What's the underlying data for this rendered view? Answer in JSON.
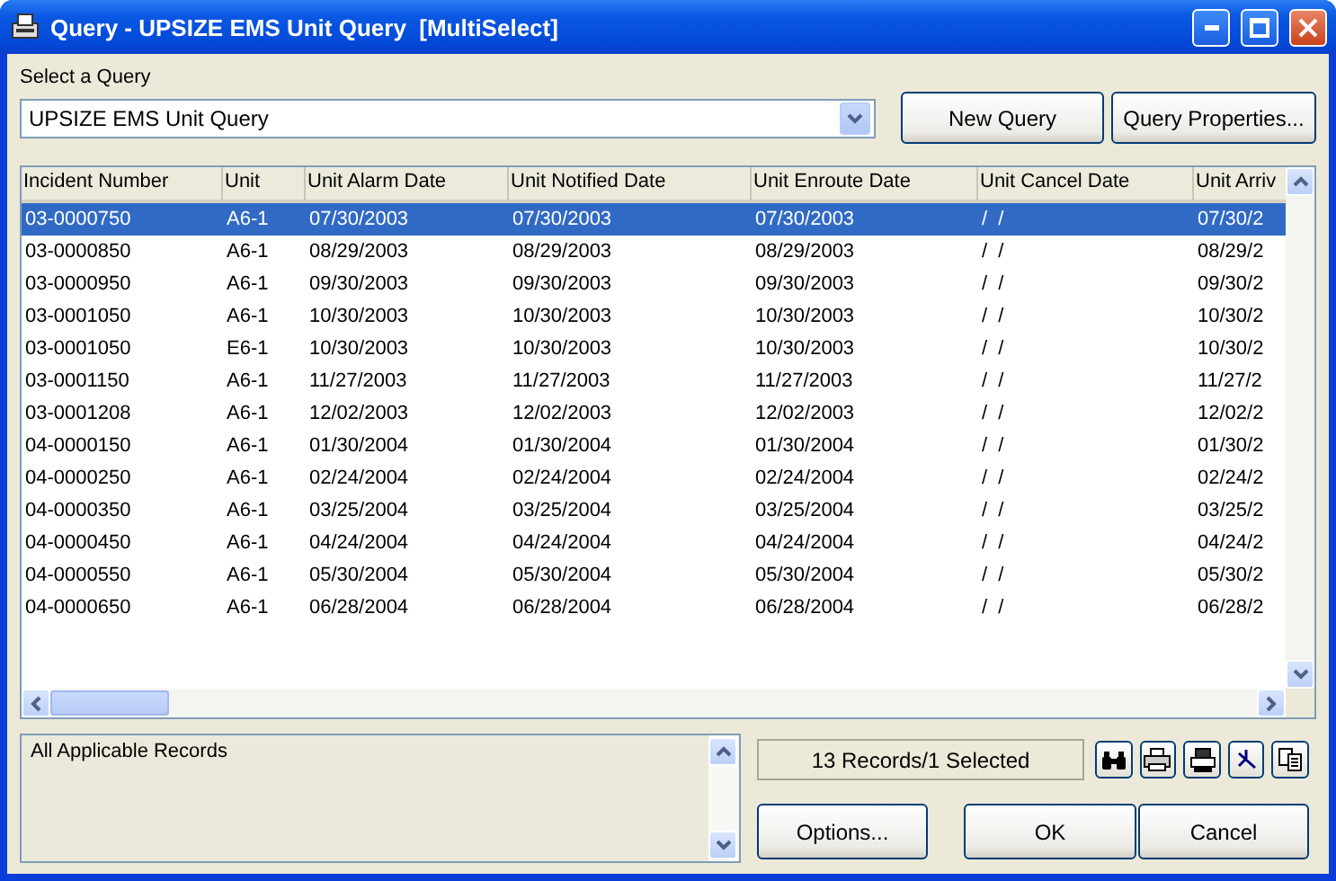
{
  "window": {
    "title": "Query - UPSIZE EMS Unit Query  [MultiSelect]"
  },
  "query_select": {
    "label": "Select a Query",
    "value": "UPSIZE EMS Unit Query"
  },
  "top_buttons": [
    "New Query",
    "Query Properties..."
  ],
  "table": {
    "columns": [
      "Incident Number",
      "Unit",
      "Unit Alarm Date",
      "Unit Notified Date",
      "Unit Enroute Date",
      "Unit Cancel Date",
      "Unit Arriv"
    ],
    "rows": [
      {
        "selected": true,
        "cells": [
          "03-0000750",
          "A6-1",
          "07/30/2003",
          "07/30/2003",
          "07/30/2003",
          "/  /",
          "07/30/2"
        ]
      },
      {
        "selected": false,
        "cells": [
          "03-0000850",
          "A6-1",
          "08/29/2003",
          "08/29/2003",
          "08/29/2003",
          "/  /",
          "08/29/2"
        ]
      },
      {
        "selected": false,
        "cells": [
          "03-0000950",
          "A6-1",
          "09/30/2003",
          "09/30/2003",
          "09/30/2003",
          "/  /",
          "09/30/2"
        ]
      },
      {
        "selected": false,
        "cells": [
          "03-0001050",
          "A6-1",
          "10/30/2003",
          "10/30/2003",
          "10/30/2003",
          "/  /",
          "10/30/2"
        ]
      },
      {
        "selected": false,
        "cells": [
          "03-0001050",
          "E6-1",
          "10/30/2003",
          "10/30/2003",
          "10/30/2003",
          "/  /",
          "10/30/2"
        ]
      },
      {
        "selected": false,
        "cells": [
          "03-0001150",
          "A6-1",
          "11/27/2003",
          "11/27/2003",
          "11/27/2003",
          "/  /",
          "11/27/2"
        ]
      },
      {
        "selected": false,
        "cells": [
          "03-0001208",
          "A6-1",
          "12/02/2003",
          "12/02/2003",
          "12/02/2003",
          "/  /",
          "12/02/2"
        ]
      },
      {
        "selected": false,
        "cells": [
          "04-0000150",
          "A6-1",
          "01/30/2004",
          "01/30/2004",
          "01/30/2004",
          "/  /",
          "01/30/2"
        ]
      },
      {
        "selected": false,
        "cells": [
          "04-0000250",
          "A6-1",
          "02/24/2004",
          "02/24/2004",
          "02/24/2004",
          "/  /",
          "02/24/2"
        ]
      },
      {
        "selected": false,
        "cells": [
          "04-0000350",
          "A6-1",
          "03/25/2004",
          "03/25/2004",
          "03/25/2004",
          "/  /",
          "03/25/2"
        ]
      },
      {
        "selected": false,
        "cells": [
          "04-0000450",
          "A6-1",
          "04/24/2004",
          "04/24/2004",
          "04/24/2004",
          "/  /",
          "04/24/2"
        ]
      },
      {
        "selected": false,
        "cells": [
          "04-0000550",
          "A6-1",
          "05/30/2004",
          "05/30/2004",
          "05/30/2004",
          "/  /",
          "05/30/2"
        ]
      },
      {
        "selected": false,
        "cells": [
          "04-0000650",
          "A6-1",
          "06/28/2004",
          "06/28/2004",
          "06/28/2004",
          "/  /",
          "06/28/2"
        ]
      }
    ]
  },
  "description": "All Applicable Records",
  "record_count": "13 Records/1 Selected",
  "bottom_buttons": [
    "Options...",
    "OK",
    "Cancel"
  ]
}
